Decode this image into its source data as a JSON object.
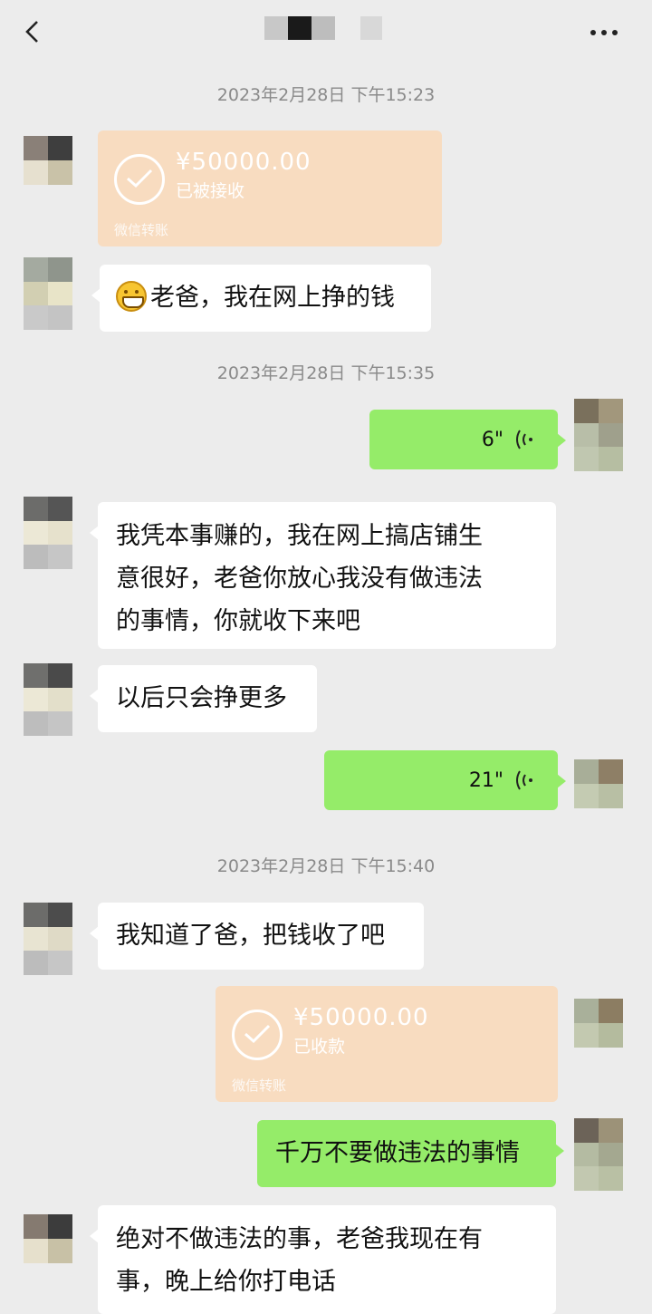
{
  "header": {
    "back_icon": "chevron-left-icon",
    "more_icon": "more-dots-icon"
  },
  "timestamps": [
    "2023年2月28日 下午15:23",
    "2023年2月28日 下午15:35",
    "2023年2月28日 下午15:40"
  ],
  "transfers": [
    {
      "amount": "¥50000.00",
      "status": "已被接收",
      "footer": "微信转账"
    },
    {
      "amount": "¥50000.00",
      "status": "已收款",
      "footer": "微信转账"
    }
  ],
  "messages": {
    "m1": "老爸，我在网上挣的钱",
    "voice1": "6\"",
    "m2_l1": "我凭本事赚的，我在网上搞店铺生",
    "m2_l2": "意很好，老爸你放心我没有做违法",
    "m2_l3": "的事情，你就收下来吧",
    "m3": "以后只会挣更多",
    "voice2": "21\"",
    "m4": "我知道了爸，把钱收了吧",
    "m5": "千万不要做违法的事情",
    "m6_l1": "绝对不做违法的事，老爸我现在有",
    "m6_l2": "事，晚上给你打电话"
  },
  "colors": {
    "bg": "#ececec",
    "green": "#95ec69",
    "white": "#ffffff",
    "transfer": "#f8dcc0"
  }
}
